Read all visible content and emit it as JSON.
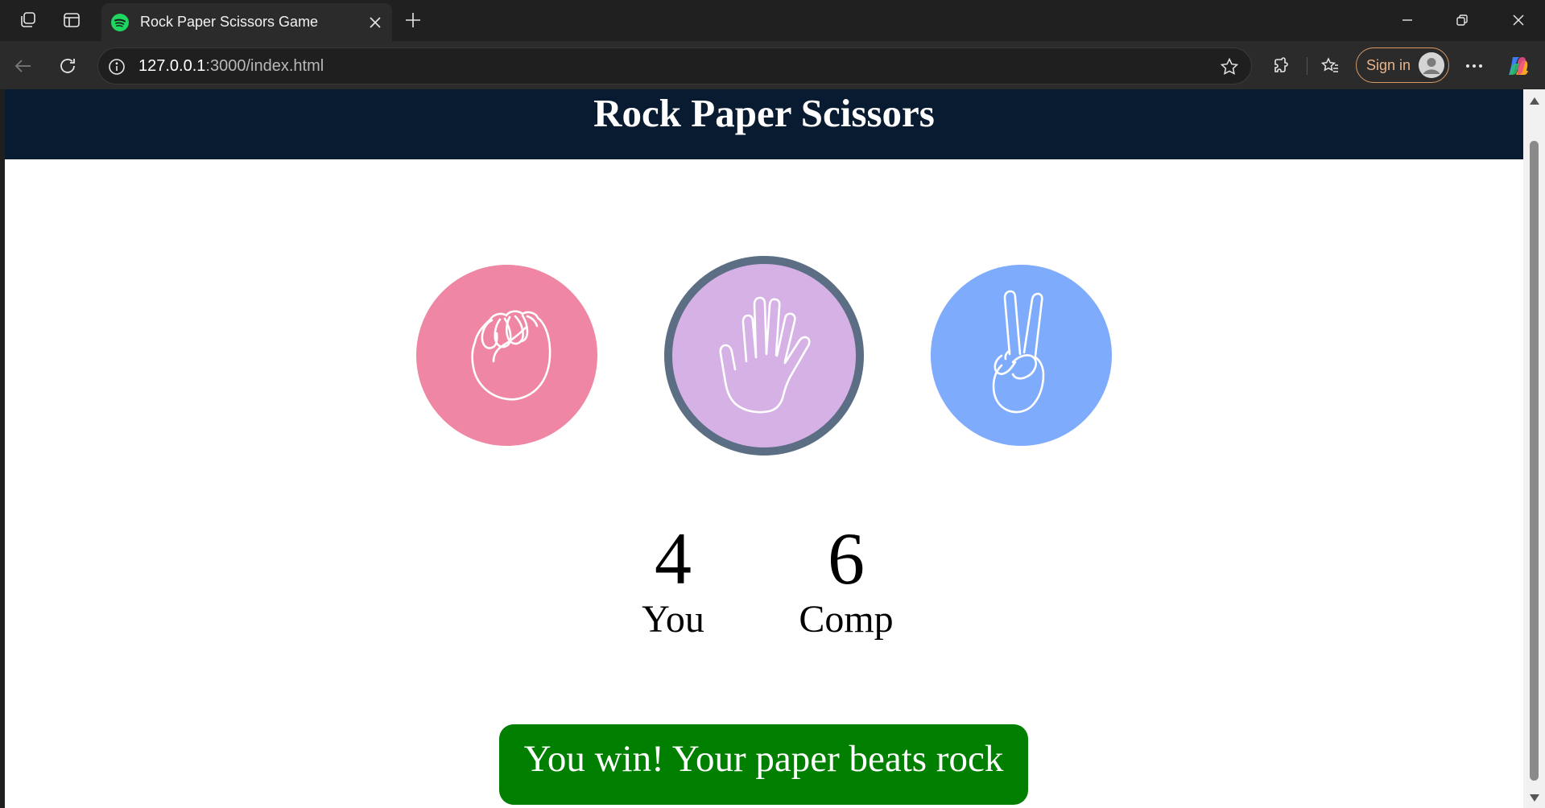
{
  "browser": {
    "tab": {
      "title": "Rock Paper Scissors Game",
      "favicon": "spotify-icon"
    },
    "url": {
      "host": "127.0.0.1",
      "path": ":3000/index.html"
    },
    "signin_label": "Sign in"
  },
  "page": {
    "title": "Rock Paper Scissors",
    "choices": [
      {
        "name": "rock",
        "icon": "fist-icon",
        "color": "#ef86a3"
      },
      {
        "name": "paper",
        "icon": "open-hand-icon",
        "color": "#d5b1e6",
        "selected": true,
        "ring_color": "#5c6e83"
      },
      {
        "name": "scissors",
        "icon": "peace-sign-icon",
        "color": "#7fabfd"
      }
    ],
    "score": {
      "user": {
        "value": "4",
        "label": "You"
      },
      "comp": {
        "value": "6",
        "label": "Comp"
      }
    },
    "message": {
      "text": "You win! Your paper beats rock",
      "color": "#007f00"
    }
  },
  "colors": {
    "header_bg": "#081b31",
    "page_bg": "#ffffff"
  }
}
